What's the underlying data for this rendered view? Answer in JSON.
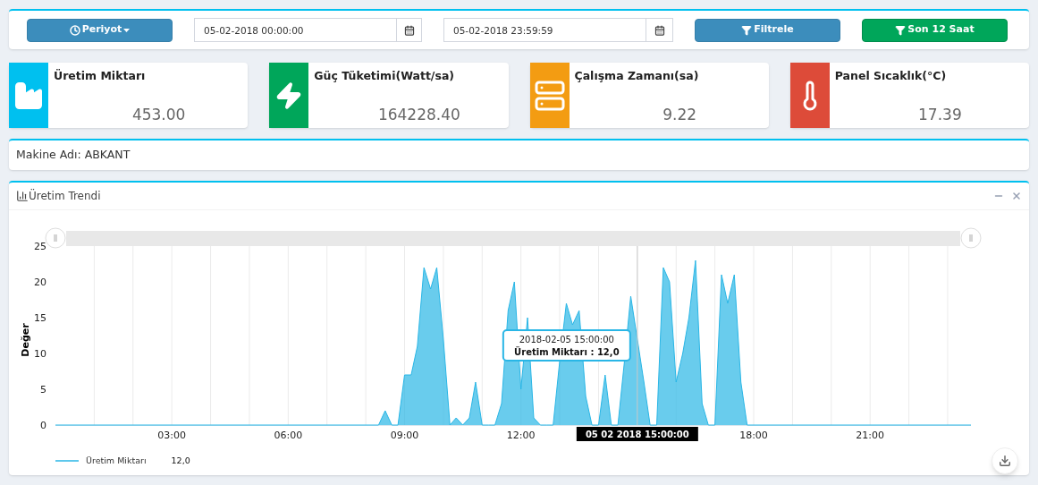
{
  "filter_bar": {
    "period_button": "Periyot",
    "start_date": {
      "value": "05-02-2018 00:00:00"
    },
    "end_date": {
      "value": "05-02-2018 23:59:59"
    },
    "filter_button": "Filtrele",
    "last_hours_button": "Son 12 Saat"
  },
  "info_boxes": [
    {
      "kind": "factory",
      "color": "#00c0ef",
      "label": "Üretim Miktarı",
      "value": "453.00"
    },
    {
      "kind": "power",
      "color": "#00a65a",
      "label": "Güç Tüketimi(Watt/sa)",
      "value": "164228.40"
    },
    {
      "kind": "runtime",
      "color": "#f39c12",
      "label": "Çalışma Zamanı(sa)",
      "value": "9.22"
    },
    {
      "kind": "temperature",
      "color": "#dd4b39",
      "label": "Panel Sıcaklık(°C)",
      "value": "17.39"
    }
  ],
  "machine": {
    "text": "Makine Adı: ABKANT"
  },
  "trend_panel": {
    "title": "Üretim Trendi",
    "chart_data": {
      "type": "area",
      "ylabel": "Değer",
      "xlim": [
        0,
        23.6
      ],
      "ylim": [
        0,
        25
      ],
      "yticks": [
        0,
        5,
        10,
        15,
        20,
        25
      ],
      "xticks": [
        {
          "value": 3,
          "label": "03:00"
        },
        {
          "value": 6,
          "label": "06:00"
        },
        {
          "value": 9,
          "label": "09:00"
        },
        {
          "value": 12,
          "label": "12:00"
        },
        {
          "value": 18,
          "label": "18:00"
        },
        {
          "value": 21,
          "label": "21:00"
        }
      ],
      "x": [
        0,
        8.33,
        8.5,
        8.67,
        8.83,
        9,
        9.17,
        9.33,
        9.5,
        9.67,
        9.83,
        10,
        10.17,
        10.33,
        10.5,
        10.67,
        10.83,
        11,
        11.17,
        11.33,
        11.5,
        11.67,
        11.83,
        12,
        12.17,
        12.33,
        12.5,
        12.67,
        12.83,
        13,
        13.17,
        13.33,
        13.5,
        13.67,
        13.83,
        14,
        14.17,
        14.33,
        14.5,
        14.67,
        14.83,
        15,
        15.17,
        15.33,
        15.5,
        15.67,
        15.83,
        16,
        16.17,
        16.33,
        16.5,
        16.67,
        16.83,
        17,
        17.17,
        17.33,
        17.5,
        17.67,
        17.83,
        23.6
      ],
      "grid": true,
      "annotations": [
        {
          "x": 15,
          "text": "05 02 2018 15:00:00"
        }
      ],
      "series": [
        {
          "name": "Üretim Miktarı",
          "color": "#29b6e6",
          "values": [
            0,
            0,
            2,
            0,
            0,
            7,
            7,
            11,
            22,
            19,
            22,
            12,
            0,
            1,
            0,
            1,
            6,
            0,
            0,
            0,
            3,
            16,
            20,
            5,
            15,
            1,
            0,
            0,
            0,
            9,
            17,
            14,
            16,
            4,
            0,
            0,
            7,
            0,
            0,
            9,
            18,
            12,
            6,
            0,
            0,
            22,
            20,
            6,
            10,
            15,
            23,
            3,
            0,
            0,
            21,
            17,
            21,
            6,
            0,
            0
          ]
        }
      ]
    },
    "tooltip": {
      "date": "2018-02-05 15:00:00",
      "text": "Üretim Miktarı : 12,0"
    },
    "legend_value": "12,0"
  }
}
